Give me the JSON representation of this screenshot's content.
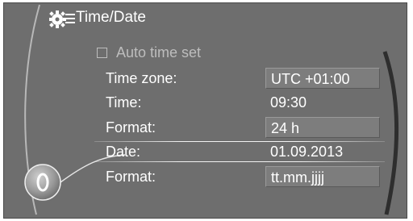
{
  "header": {
    "title": "Time/Date",
    "icon": "settings-gear-icon"
  },
  "auto_time_set": {
    "label": "Auto time set",
    "checked": false,
    "enabled": false
  },
  "rows": [
    {
      "label": "Time zone:",
      "value": "UTC +01:00",
      "boxed": true
    },
    {
      "label": "Time:",
      "value": "09:30",
      "boxed": false
    },
    {
      "label": "Format:",
      "value": "24 h",
      "boxed": true
    },
    {
      "label": "Date:",
      "value": "01.09.2013",
      "boxed": false,
      "selected": true
    },
    {
      "label": "Format:",
      "value": "tt.mm.jjjj",
      "boxed": true
    }
  ],
  "controller": {
    "icon": "controller-knob-icon"
  },
  "colors": {
    "background": "#6e6e6e",
    "text": "#ffffff",
    "disabled_text": "#bdbdbd",
    "highlight_line": "#f2f2f2"
  }
}
